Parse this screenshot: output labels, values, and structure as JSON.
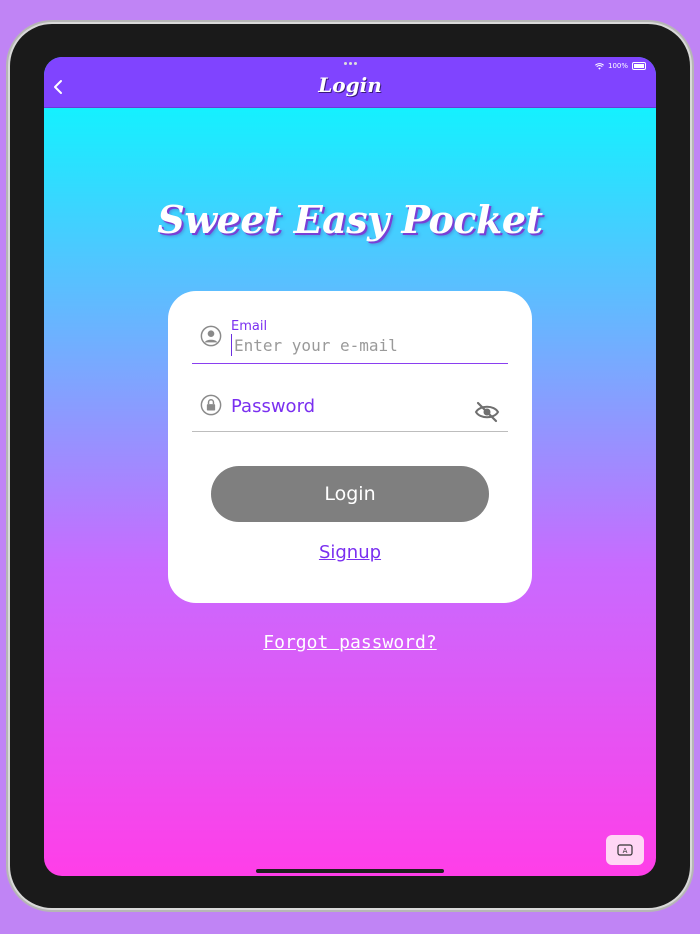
{
  "status_bar": {
    "battery": "100%"
  },
  "nav": {
    "title": "Login",
    "back_icon": "chevron-left-icon"
  },
  "app": {
    "title": "Sweet Easy Pocket"
  },
  "form": {
    "email_label": "Email",
    "email_placeholder": "Enter your e-mail",
    "email_value": "",
    "password_placeholder": "Password",
    "login_label": "Login",
    "signup_label": "Signup"
  },
  "links": {
    "forgot_password": "Forgot password?"
  },
  "keyboard_button": {
    "glyph": "A"
  },
  "colors": {
    "nav_bar": "#8044ff",
    "accent": "#7a2ff0",
    "gradient_top": "#00ffff",
    "gradient_bottom": "#ff3ee8",
    "button_disabled": "#7f7f7f",
    "background": "#c084f5"
  }
}
